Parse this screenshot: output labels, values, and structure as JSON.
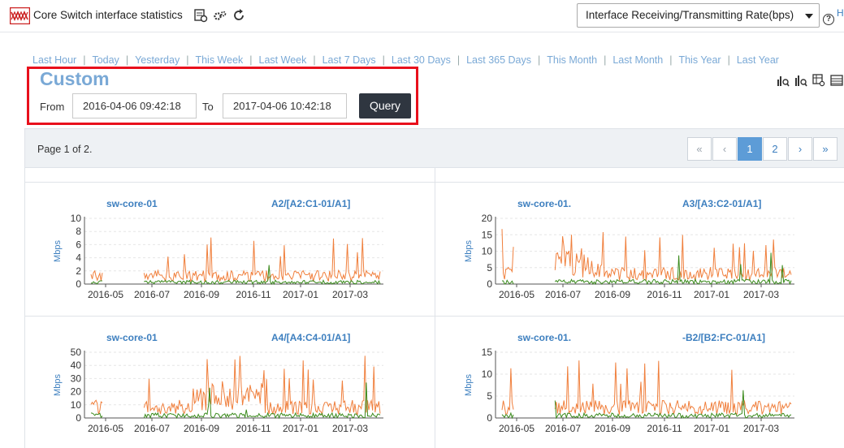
{
  "header": {
    "title": "Core Switch interface statistics",
    "metric_select": "Interface Receiving/Transmitting Rate(bps)",
    "help_label": "H",
    "icons": [
      "app-logo-icon",
      "export-icon",
      "settings-icon",
      "refresh-icon",
      "help-icon"
    ]
  },
  "time_ranges": [
    "Last Hour",
    "Today",
    "Yesterday",
    "This Week",
    "Last Week",
    "Last 7 Days",
    "Last 30 Days",
    "Last 365 Days",
    "This Month",
    "Last Month",
    "This Year",
    "Last Year"
  ],
  "custom": {
    "title": "Custom",
    "from_label": "From",
    "from_value": "2016-04-06 09:42:18",
    "to_label": "To",
    "to_value": "2017-04-06 10:42:18",
    "query_label": "Query"
  },
  "toolbar_icons": [
    "chart-view-icon",
    "chart-zoom-icon",
    "chart-table-icon",
    "list-view-icon"
  ],
  "pager": {
    "info": "Page 1 of 2.",
    "buttons": [
      "«",
      "‹",
      "1",
      "2",
      "›",
      "»"
    ],
    "active": "1"
  },
  "colors": {
    "receive": "#f07f3c",
    "transmit": "#3a8a1c",
    "accent": "#7aa9d6",
    "highlight": "#e8101c"
  },
  "charts": [
    {
      "title_device": "sw-core-01",
      "title_port": "A2/[A2:C1-01/A1]",
      "ylabel": "Mbps",
      "ymax": 10,
      "yticks": [
        0,
        2,
        4,
        6,
        8,
        10
      ],
      "xticks": [
        "2016-05",
        "2016-07",
        "2016-09",
        "2016-11",
        "2017-01",
        "2017-03"
      ],
      "peak": 7.2,
      "gap_end": 0.18,
      "seed": 11
    },
    {
      "title_device": "sw-core-01.",
      "title_port": "A3/[A3:C2-01/A1]",
      "ylabel": "Mbps",
      "ymax": 20,
      "yticks": [
        0,
        5,
        10,
        15,
        20
      ],
      "xticks": [
        "2016-05",
        "2016-07",
        "2016-09",
        "2016-11",
        "2017-01",
        "2017-03"
      ],
      "peak": 18,
      "gap_end": 0.18,
      "seed": 23
    },
    {
      "title_device": "sw-core-01",
      "title_port": "A4/[A4:C4-01/A1]",
      "ylabel": "Mbps",
      "ymax": 50,
      "yticks": [
        0,
        10,
        20,
        30,
        40,
        50
      ],
      "xticks": [
        "2016-05",
        "2016-07",
        "2016-09",
        "2016-11",
        "2017-01",
        "2017-03"
      ],
      "peak": 48,
      "gap_end": 0.18,
      "seed": 37
    },
    {
      "title_device": "sw-core-01.",
      "title_port": "-B2/[B2:FC-01/A1]",
      "ylabel": "Mbps",
      "ymax": 15,
      "yticks": [
        0,
        5,
        10,
        15
      ],
      "xticks": [
        "2016-05",
        "2016-07",
        "2016-09",
        "2016-11",
        "2017-01",
        "2017-03"
      ],
      "peak": 14,
      "gap_end": 0.18,
      "seed": 53
    }
  ]
}
